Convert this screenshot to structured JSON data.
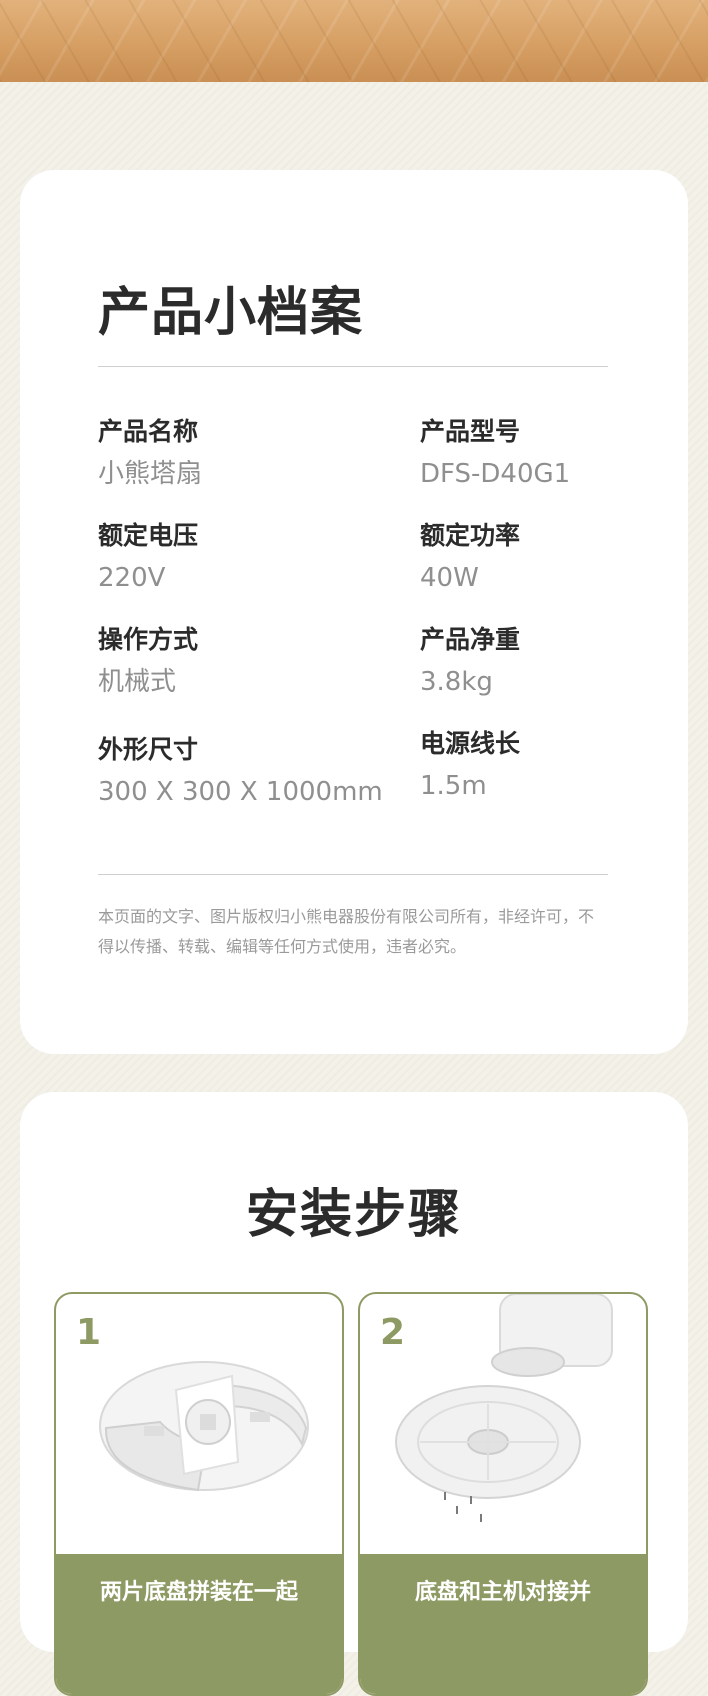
{
  "profile": {
    "title": "产品小档案",
    "specs": [
      {
        "label": "产品名称",
        "value": "小熊塔扇"
      },
      {
        "label": "产品型号",
        "value": "DFS-D40G1"
      },
      {
        "label": "额定电压",
        "value": "220V"
      },
      {
        "label": "额定功率",
        "value": "40W"
      },
      {
        "label": "操作方式",
        "value": "机械式"
      },
      {
        "label": "产品净重",
        "value": "3.8kg"
      },
      {
        "label": "外形尺寸",
        "value": "300 X 300 X 1000mm"
      },
      {
        "label": "电源线长",
        "value": "1.5m"
      }
    ],
    "copyright": "本页面的文字、图片版权归小熊电器股份有限公司所有，非经许可，不得以传播、转载、编辑等任何方式使用，违者必究。"
  },
  "install": {
    "title": "安装步骤",
    "steps": [
      {
        "number": "1",
        "caption": "两片底盘拼装在一起"
      },
      {
        "number": "2",
        "caption": "底盘和主机对接并"
      }
    ]
  },
  "colors": {
    "accent": "#8e9a63",
    "background": "#f3f1e8",
    "card": "#ffffff",
    "heading": "#2b2b2b",
    "value": "#8f8f8f"
  }
}
